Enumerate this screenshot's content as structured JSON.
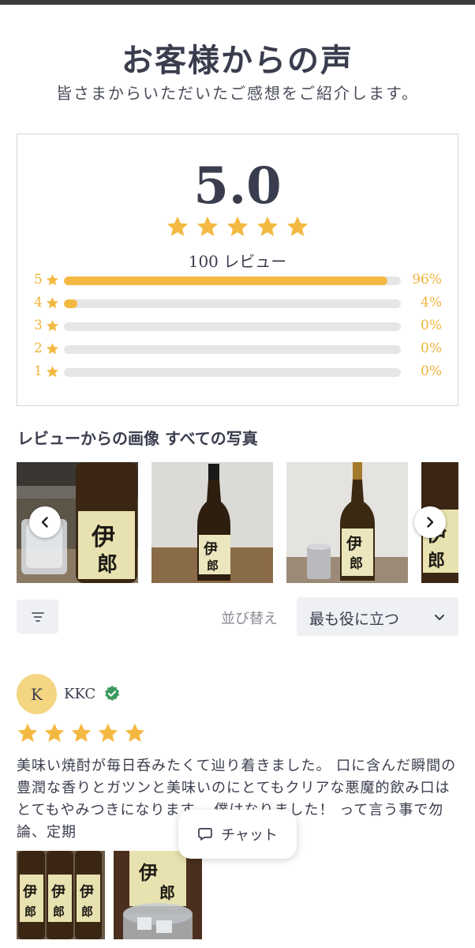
{
  "header": {
    "title": "お客様からの声",
    "subtitle": "皆さまからいただいたご感想をご紹介します。"
  },
  "summary": {
    "average": "5.0",
    "rating": 5,
    "review_count_label": "100 レビュー",
    "distribution": [
      {
        "stars": "5",
        "percent_label": "96%",
        "fraction": 0.96
      },
      {
        "stars": "4",
        "percent_label": "4%",
        "fraction": 0.04
      },
      {
        "stars": "3",
        "percent_label": "0%",
        "fraction": 0
      },
      {
        "stars": "2",
        "percent_label": "0%",
        "fraction": 0
      },
      {
        "stars": "1",
        "percent_label": "0%",
        "fraction": 0
      }
    ]
  },
  "gallery": {
    "title": "レビューからの画像 すべての写真",
    "prev_icon": "chevron-left-icon",
    "next_icon": "chevron-right-icon"
  },
  "controls": {
    "filter_icon": "filter-icon",
    "sort_label": "並び替え",
    "sort_value": "最も役に立つ"
  },
  "review": {
    "avatar_initial": "K",
    "name": "KKC",
    "rating": 5,
    "text": "美味い焼酎が毎日呑みたくて辿り着きました。 口に含んだ瞬間の豊潤な香りとガツンと美味いのにとてもクリアな悪魔的飲み口はとてもやみつきになります。 僕はなりました！ って言う事で勿論、定期"
  },
  "chat": {
    "label": "チャット",
    "icon": "chat-bubble-icon"
  },
  "colors": {
    "star": "#f4b942",
    "text": "#3a3d4d",
    "track": "#e6e6e6",
    "verified": "#3d9a5f",
    "avatar_bg": "#f3d582"
  }
}
